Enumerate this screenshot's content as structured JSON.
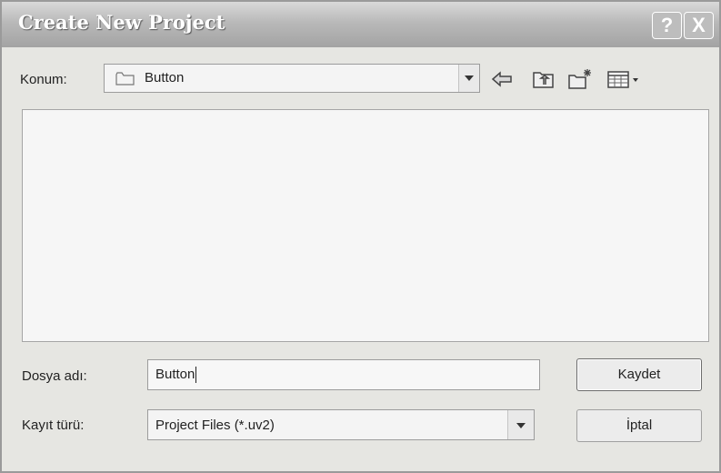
{
  "window": {
    "title": "Create New Project",
    "help_label": "?",
    "close_label": "X"
  },
  "toolbar": {
    "look_in_label": "Konum:",
    "look_in_value": "Button",
    "icons": [
      "back-arrow-icon",
      "up-folder-icon",
      "new-folder-icon",
      "view-menu-icon"
    ]
  },
  "form": {
    "file_name_label": "Dosya adı:",
    "file_name_value": "Button",
    "file_type_label": "Kayıt türü:",
    "file_type_value": "Project Files (*.uv2)"
  },
  "buttons": {
    "save_label": "Kaydet",
    "cancel_label": "İptal"
  }
}
